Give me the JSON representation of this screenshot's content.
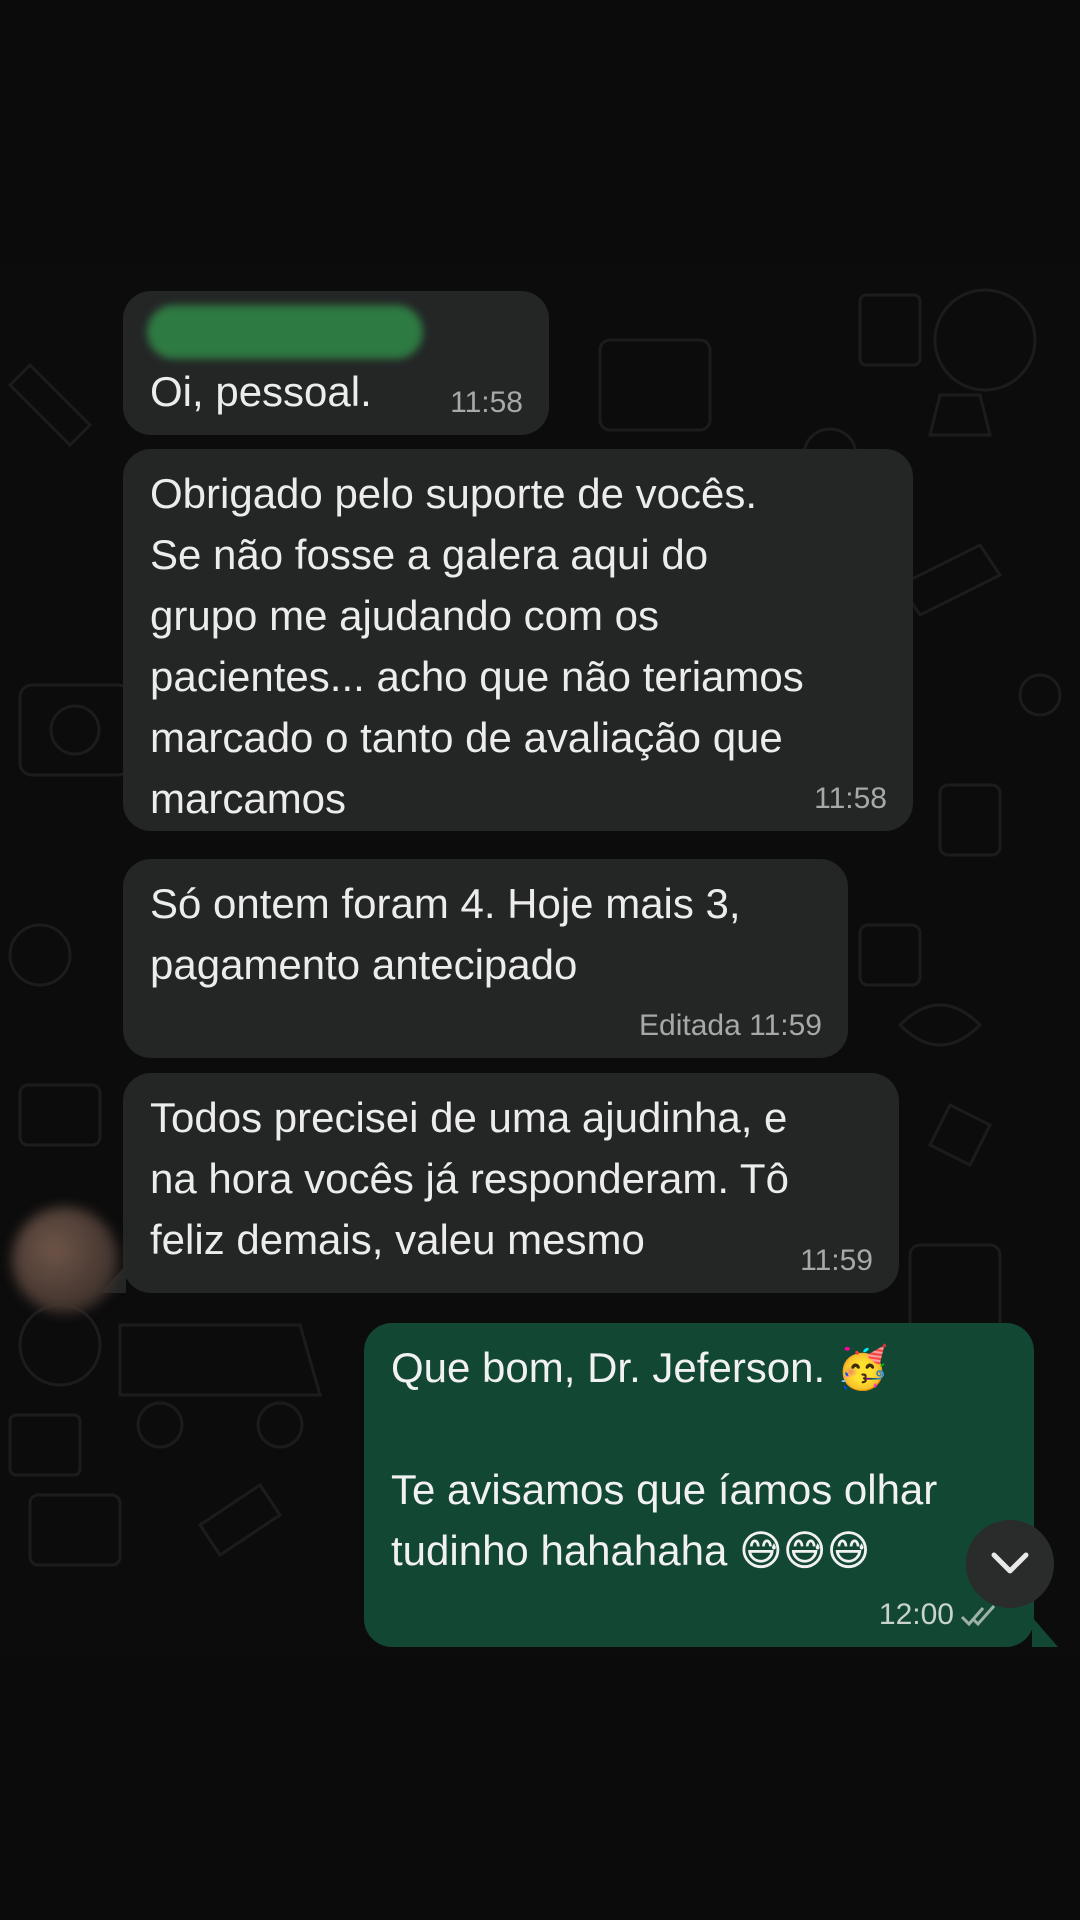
{
  "messages": [
    {
      "id": "m1",
      "direction": "incoming",
      "sender_hidden": true,
      "text": "Oi, pessoal.",
      "time": "11:58",
      "edited_label": ""
    },
    {
      "id": "m2",
      "direction": "incoming",
      "text": "Obrigado pelo suporte de vocês.\nSe não fosse a galera aqui do\ngrupo me ajudando com os\npacientes... acho que não teriamos\nmarcado o tanto de avaliação que\nmarcamos",
      "time": "11:58",
      "edited_label": ""
    },
    {
      "id": "m3",
      "direction": "incoming",
      "text": "Só ontem foram 4. Hoje mais 3,\npagamento antecipado",
      "time": "11:59",
      "edited_label": "Editada"
    },
    {
      "id": "m4",
      "direction": "incoming",
      "text": "Todos precisei de uma ajudinha, e\nna hora vocês já responderam. Tô\nfeliz demais, valeu mesmo",
      "time": "11:59",
      "edited_label": ""
    },
    {
      "id": "m5",
      "direction": "outgoing",
      "text": "Que bom, Dr. Jeferson. 🥳\n\nTe avisamos que íamos olhar\ntudinho hahahaha 😅😅😅",
      "time": "12:00",
      "edited_label": "",
      "status": "read-double-check-icon"
    }
  ],
  "icons": {
    "scroll_down": "chevron-down-icon",
    "read_receipt": "double-check-icon"
  },
  "colors": {
    "incoming_bubble": "#242626",
    "outgoing_bubble": "#124734",
    "background": "#0b0b0b"
  }
}
